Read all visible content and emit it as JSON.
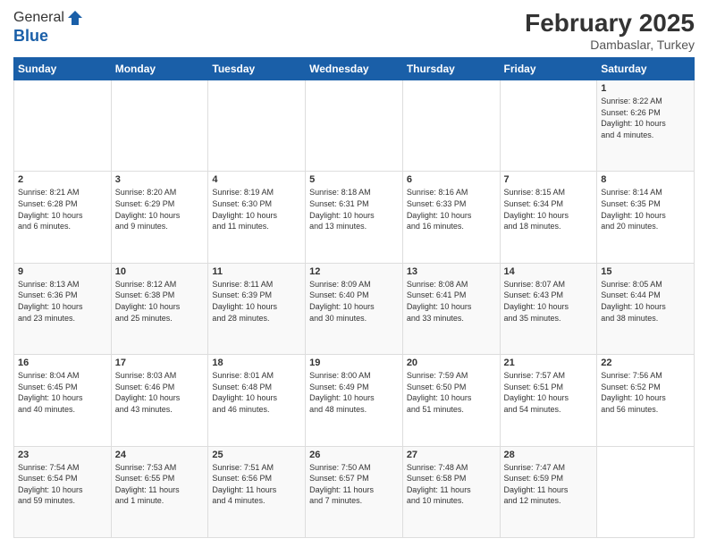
{
  "logo": {
    "general": "General",
    "blue": "Blue"
  },
  "title": {
    "main": "February 2025",
    "sub": "Dambaslar, Turkey"
  },
  "weekdays": [
    "Sunday",
    "Monday",
    "Tuesday",
    "Wednesday",
    "Thursday",
    "Friday",
    "Saturday"
  ],
  "weeks": [
    [
      {
        "day": "",
        "info": ""
      },
      {
        "day": "",
        "info": ""
      },
      {
        "day": "",
        "info": ""
      },
      {
        "day": "",
        "info": ""
      },
      {
        "day": "",
        "info": ""
      },
      {
        "day": "",
        "info": ""
      },
      {
        "day": "1",
        "info": "Sunrise: 8:22 AM\nSunset: 6:26 PM\nDaylight: 10 hours\nand 4 minutes."
      }
    ],
    [
      {
        "day": "2",
        "info": "Sunrise: 8:21 AM\nSunset: 6:28 PM\nDaylight: 10 hours\nand 6 minutes."
      },
      {
        "day": "3",
        "info": "Sunrise: 8:20 AM\nSunset: 6:29 PM\nDaylight: 10 hours\nand 9 minutes."
      },
      {
        "day": "4",
        "info": "Sunrise: 8:19 AM\nSunset: 6:30 PM\nDaylight: 10 hours\nand 11 minutes."
      },
      {
        "day": "5",
        "info": "Sunrise: 8:18 AM\nSunset: 6:31 PM\nDaylight: 10 hours\nand 13 minutes."
      },
      {
        "day": "6",
        "info": "Sunrise: 8:16 AM\nSunset: 6:33 PM\nDaylight: 10 hours\nand 16 minutes."
      },
      {
        "day": "7",
        "info": "Sunrise: 8:15 AM\nSunset: 6:34 PM\nDaylight: 10 hours\nand 18 minutes."
      },
      {
        "day": "8",
        "info": "Sunrise: 8:14 AM\nSunset: 6:35 PM\nDaylight: 10 hours\nand 20 minutes."
      }
    ],
    [
      {
        "day": "9",
        "info": "Sunrise: 8:13 AM\nSunset: 6:36 PM\nDaylight: 10 hours\nand 23 minutes."
      },
      {
        "day": "10",
        "info": "Sunrise: 8:12 AM\nSunset: 6:38 PM\nDaylight: 10 hours\nand 25 minutes."
      },
      {
        "day": "11",
        "info": "Sunrise: 8:11 AM\nSunset: 6:39 PM\nDaylight: 10 hours\nand 28 minutes."
      },
      {
        "day": "12",
        "info": "Sunrise: 8:09 AM\nSunset: 6:40 PM\nDaylight: 10 hours\nand 30 minutes."
      },
      {
        "day": "13",
        "info": "Sunrise: 8:08 AM\nSunset: 6:41 PM\nDaylight: 10 hours\nand 33 minutes."
      },
      {
        "day": "14",
        "info": "Sunrise: 8:07 AM\nSunset: 6:43 PM\nDaylight: 10 hours\nand 35 minutes."
      },
      {
        "day": "15",
        "info": "Sunrise: 8:05 AM\nSunset: 6:44 PM\nDaylight: 10 hours\nand 38 minutes."
      }
    ],
    [
      {
        "day": "16",
        "info": "Sunrise: 8:04 AM\nSunset: 6:45 PM\nDaylight: 10 hours\nand 40 minutes."
      },
      {
        "day": "17",
        "info": "Sunrise: 8:03 AM\nSunset: 6:46 PM\nDaylight: 10 hours\nand 43 minutes."
      },
      {
        "day": "18",
        "info": "Sunrise: 8:01 AM\nSunset: 6:48 PM\nDaylight: 10 hours\nand 46 minutes."
      },
      {
        "day": "19",
        "info": "Sunrise: 8:00 AM\nSunset: 6:49 PM\nDaylight: 10 hours\nand 48 minutes."
      },
      {
        "day": "20",
        "info": "Sunrise: 7:59 AM\nSunset: 6:50 PM\nDaylight: 10 hours\nand 51 minutes."
      },
      {
        "day": "21",
        "info": "Sunrise: 7:57 AM\nSunset: 6:51 PM\nDaylight: 10 hours\nand 54 minutes."
      },
      {
        "day": "22",
        "info": "Sunrise: 7:56 AM\nSunset: 6:52 PM\nDaylight: 10 hours\nand 56 minutes."
      }
    ],
    [
      {
        "day": "23",
        "info": "Sunrise: 7:54 AM\nSunset: 6:54 PM\nDaylight: 10 hours\nand 59 minutes."
      },
      {
        "day": "24",
        "info": "Sunrise: 7:53 AM\nSunset: 6:55 PM\nDaylight: 11 hours\nand 1 minute."
      },
      {
        "day": "25",
        "info": "Sunrise: 7:51 AM\nSunset: 6:56 PM\nDaylight: 11 hours\nand 4 minutes."
      },
      {
        "day": "26",
        "info": "Sunrise: 7:50 AM\nSunset: 6:57 PM\nDaylight: 11 hours\nand 7 minutes."
      },
      {
        "day": "27",
        "info": "Sunrise: 7:48 AM\nSunset: 6:58 PM\nDaylight: 11 hours\nand 10 minutes."
      },
      {
        "day": "28",
        "info": "Sunrise: 7:47 AM\nSunset: 6:59 PM\nDaylight: 11 hours\nand 12 minutes."
      },
      {
        "day": "",
        "info": ""
      }
    ]
  ]
}
